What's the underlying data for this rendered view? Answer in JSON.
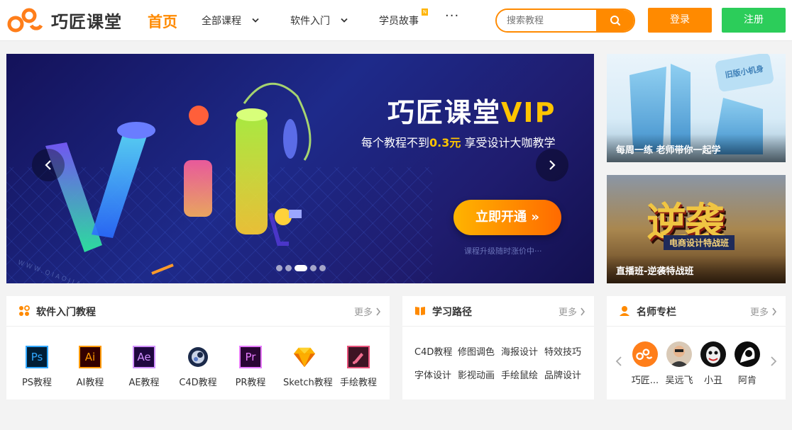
{
  "header": {
    "logo_text": "巧匠课堂",
    "nav_home": "首页",
    "nav_items": [
      {
        "label": "全部课程"
      },
      {
        "label": "软件入门"
      },
      {
        "label": "学员故事",
        "badge": "N"
      }
    ],
    "more_glyph": "···",
    "search_placeholder": "搜索教程",
    "login_label": "登录",
    "register_label": "注册",
    "accent_color": "#ff8a00",
    "register_color": "#2ccd5a"
  },
  "banner": {
    "title_prefix": "巧匠课堂",
    "title_vip": "VIP",
    "subtitle_prefix": "每个教程不到",
    "subtitle_highlight": "0.3元",
    "subtitle_suffix": " 享受设计大咖教学",
    "cta_label": "立即开通 »",
    "note": "课程升级随时涨价中···",
    "watermark": "WWW.QIAOJIANG.TV",
    "slide_count": 5,
    "active_slide": 3
  },
  "promos": [
    {
      "caption": "每周一练 老师带你一起学",
      "bubble": "旧版小机身"
    },
    {
      "caption": "直播班-逆袭特战班",
      "big_text": "逆袭",
      "big_sub": "电商设计特战班"
    }
  ],
  "cards": {
    "software": {
      "title": "软件入门教程",
      "more": "更多",
      "items": [
        {
          "label": "PS教程",
          "icon": "ps-icon",
          "glyph": "Ps",
          "fg": "#31a8ff",
          "bg": "#001e36"
        },
        {
          "label": "AI教程",
          "icon": "ai-icon",
          "glyph": "Ai",
          "fg": "#ff9a00",
          "bg": "#330000"
        },
        {
          "label": "AE教程",
          "icon": "ae-icon",
          "glyph": "Ae",
          "fg": "#d291ff",
          "bg": "#1f0740"
        },
        {
          "label": "C4D教程",
          "icon": "c4d-icon"
        },
        {
          "label": "PR教程",
          "icon": "pr-icon",
          "glyph": "Pr",
          "fg": "#e77bff",
          "bg": "#2a0634"
        },
        {
          "label": "Sketch教程",
          "icon": "sketch-icon"
        },
        {
          "label": "手绘教程",
          "icon": "brush-icon"
        }
      ]
    },
    "paths": {
      "title": "学习路径",
      "more": "更多",
      "rows": [
        [
          "C4D教程",
          "修图调色",
          "海报设计",
          "特效技巧"
        ],
        [
          "字体设计",
          "影视动画",
          "手绘鼠绘",
          "品牌设计"
        ]
      ]
    },
    "teachers": {
      "title": "名师专栏",
      "more": "更多",
      "items": [
        {
          "name": "巧匠...",
          "avatar": "logo-avatar"
        },
        {
          "name": "吴远飞",
          "avatar": "person-avatar"
        },
        {
          "name": "小丑",
          "avatar": "joker-avatar"
        },
        {
          "name": "阿肯",
          "avatar": "dark-avatar"
        }
      ]
    }
  }
}
